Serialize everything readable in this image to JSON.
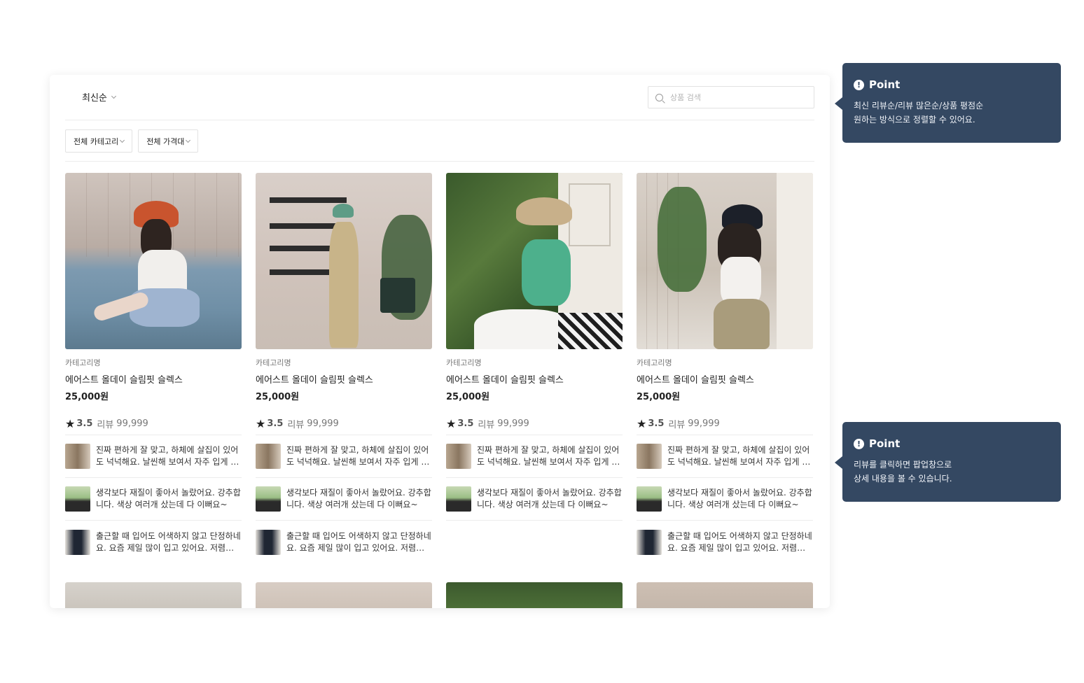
{
  "toolbar": {
    "sort_label": "최신순",
    "search_placeholder": "상품 검색"
  },
  "filters": [
    {
      "label": "전체 카테고리"
    },
    {
      "label": "전체 가격대"
    }
  ],
  "products": [
    {
      "category": "카테고리명",
      "name": "에어스트 올데이 슬림핏 슬렉스",
      "price": "25,000원",
      "rating": "3.5",
      "review_label": "리뷰",
      "review_count": "99,999",
      "reviews": [
        {
          "text": "진짜 편하게 잘 맞고, 하체에 살집이 있어도 넉넉해요. 날씬해 보여서 자주 입게 되네요."
        },
        {
          "text": "생각보다 재질이 좋아서 놀랐어요. 강추합니다. 색상 여러개 샀는데 다 이뻐요~"
        },
        {
          "text": "출근할 때 입어도 어색하지 않고 단정하네요. 요즘 제일 많이 입고 있어요. 저렴한 가격이에요."
        }
      ]
    },
    {
      "category": "카테고리명",
      "name": "에어스트 올데이 슬림핏 슬렉스",
      "price": "25,000원",
      "rating": "3.5",
      "review_label": "리뷰",
      "review_count": "99,999",
      "reviews": [
        {
          "text": "진짜 편하게 잘 맞고, 하체에 살집이 있어도 넉넉해요. 날씬해 보여서 자주 입게 되네요."
        },
        {
          "text": "생각보다 재질이 좋아서 놀랐어요. 강추합니다. 색상 여러개 샀는데 다 이뻐요~"
        },
        {
          "text": "출근할 때 입어도 어색하지 않고 단정하네요. 요즘 제일 많이 입고 있어요. 저렴한 가격이에요."
        }
      ]
    },
    {
      "category": "카테고리명",
      "name": "에어스트 올데이 슬림핏 슬렉스",
      "price": "25,000원",
      "rating": "3.5",
      "review_label": "리뷰",
      "review_count": "99,999",
      "reviews": [
        {
          "text": "진짜 편하게 잘 맞고, 하체에 살집이 있어도 넉넉해요. 날씬해 보여서 자주 입게 되네요."
        },
        {
          "text": "생각보다 재질이 좋아서 놀랐어요. 강추합니다. 색상 여러개 샀는데 다 이뻐요~"
        }
      ]
    },
    {
      "category": "카테고리명",
      "name": "에어스트 올데이 슬림핏 슬렉스",
      "price": "25,000원",
      "rating": "3.5",
      "review_label": "리뷰",
      "review_count": "99,999",
      "reviews": [
        {
          "text": "진짜 편하게 잘 맞고, 하체에 살집이 있어도 넉넉해요. 날씬해 보여서 자주 입게 되네요."
        },
        {
          "text": "생각보다 재질이 좋아서 놀랐어요. 강추합니다. 색상 여러개 샀는데 다 이뻐요~"
        },
        {
          "text": "출근할 때 입어도 어색하지 않고 단정하네요. 요즘 제일 많이 입고 있어요. 저렴한 가격이에요."
        }
      ]
    }
  ],
  "tooltips": [
    {
      "title": "Point",
      "lines": [
        "최신 리뷰순/리뷰 많은순/상품 평점순",
        "원하는 방식으로 정렬할 수 있어요."
      ]
    },
    {
      "title": "Point",
      "lines": [
        "리뷰를 클릭하면 팝업창으로",
        "상세 내용을 볼 수 있습니다."
      ]
    }
  ],
  "colors": {
    "tooltip_bg": "#344862",
    "text_primary": "#222222",
    "divider": "#ececec"
  },
  "icons": {
    "search": "search-icon",
    "star": "star-icon",
    "chevron": "chevron-down-icon",
    "alert": "exclamation-circle-icon"
  }
}
